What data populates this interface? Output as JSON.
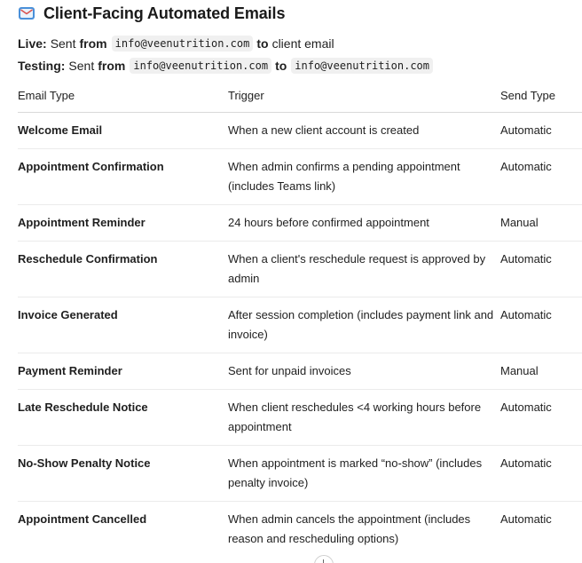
{
  "header": {
    "title": "Client-Facing Automated Emails",
    "icon": "envelope-icon"
  },
  "live": {
    "label": "Live:",
    "sent": "Sent",
    "from_word": "from",
    "from_email": "info@veenutrition.com",
    "to_word": "to",
    "to_text": "client email"
  },
  "testing": {
    "label": "Testing:",
    "sent": "Sent",
    "from_word": "from",
    "from_email": "info@veenutrition.com",
    "to_word": "to",
    "to_email": "info@veenutrition.com"
  },
  "table": {
    "headers": [
      "Email Type",
      "Trigger",
      "Send Type"
    ],
    "rows": [
      {
        "type": "Welcome Email",
        "trigger": "When a new client account is created",
        "send": "Automatic"
      },
      {
        "type": "Appointment Confirmation",
        "trigger": "When admin confirms a pending appointment (includes Teams link)",
        "send": "Automatic"
      },
      {
        "type": "Appointment Reminder",
        "trigger": "24 hours before confirmed appointment",
        "send": "Manual"
      },
      {
        "type": "Reschedule Confirmation",
        "trigger": "When a client's reschedule request is approved by admin",
        "send": "Automatic"
      },
      {
        "type": "Invoice Generated",
        "trigger": "After session completion (includes payment link and invoice)",
        "send": "Automatic"
      },
      {
        "type": "Payment Reminder",
        "trigger": "Sent for unpaid invoices",
        "send": "Manual"
      },
      {
        "type": "Late Reschedule Notice",
        "trigger": "When client reschedules <4 working hours before appointment",
        "send": "Automatic"
      },
      {
        "type": "No-Show Penalty Notice",
        "trigger": "When appointment is marked “no-show” (includes penalty invoice)",
        "send": "Automatic"
      },
      {
        "type": "Appointment Cancelled",
        "trigger": "When admin cancels the appointment (includes reason and rescheduling options)",
        "send": "Automatic"
      }
    ]
  }
}
